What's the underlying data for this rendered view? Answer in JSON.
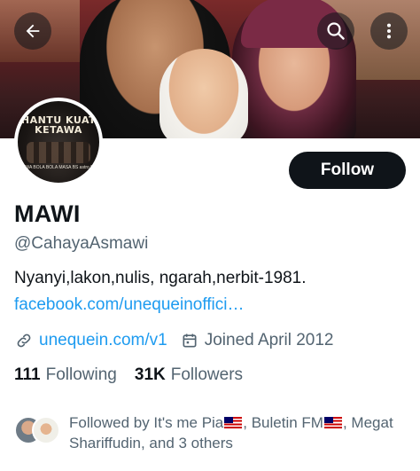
{
  "header": {
    "back_icon": "arrow-left-icon",
    "search_icon": "search-icon",
    "more_icon": "more-vertical-icon"
  },
  "avatar": {
    "poster_title": "HANTU KUAT KETAWA",
    "poster_sub": "SEWA BOLA BOLA MASA BS astro first"
  },
  "profile": {
    "follow_label": "Follow",
    "display_name": "MAWI",
    "handle": "@CahayaAsmawi",
    "bio": "Nyanyi,lakon,nulis, ngarah,nerbit-1981.",
    "bio_link": "facebook.com/unequeinoffici…",
    "website": "unequein.com/v1",
    "joined": "Joined April 2012",
    "following_count": "111",
    "following_label": "Following",
    "followers_count": "31K",
    "followers_label": "Followers",
    "followed_by_prefix": "Followed by It's me Pia",
    "followed_by_mid": ", Buletin FM",
    "followed_by_suffix": ", Megat Shariffudin, and 3 others"
  },
  "colors": {
    "accent": "#1d9bf0",
    "text_primary": "#0f1419",
    "text_secondary": "#536471",
    "button_bg": "#0f1419"
  }
}
